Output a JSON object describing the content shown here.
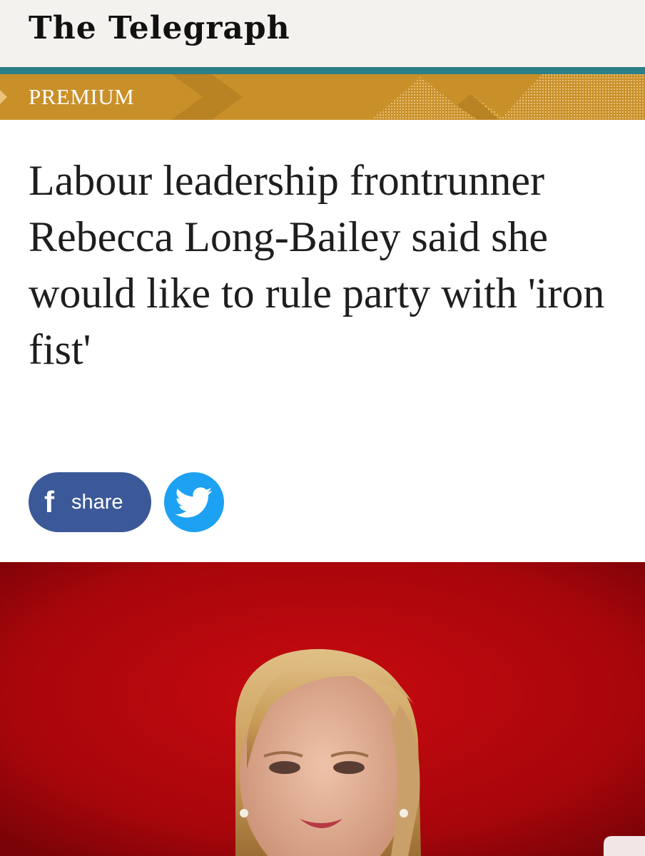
{
  "masthead": {
    "title": "The Telegraph"
  },
  "section": {
    "label": "PREMIUM"
  },
  "article": {
    "headline": "Labour leadership frontrunner Rebecca Long-Bailey said she would like to rule party with 'iron fist'"
  },
  "share": {
    "facebook_icon": "f",
    "facebook_label": "share",
    "twitter_icon": "twitter-bird-icon"
  },
  "colors": {
    "masthead_bg": "#f4f2ef",
    "teal_accent": "#2b7f86",
    "premium_gold": "#c9902a",
    "facebook_blue": "#3b5998",
    "twitter_blue": "#1da1f2",
    "photo_red": "#b5070c"
  }
}
